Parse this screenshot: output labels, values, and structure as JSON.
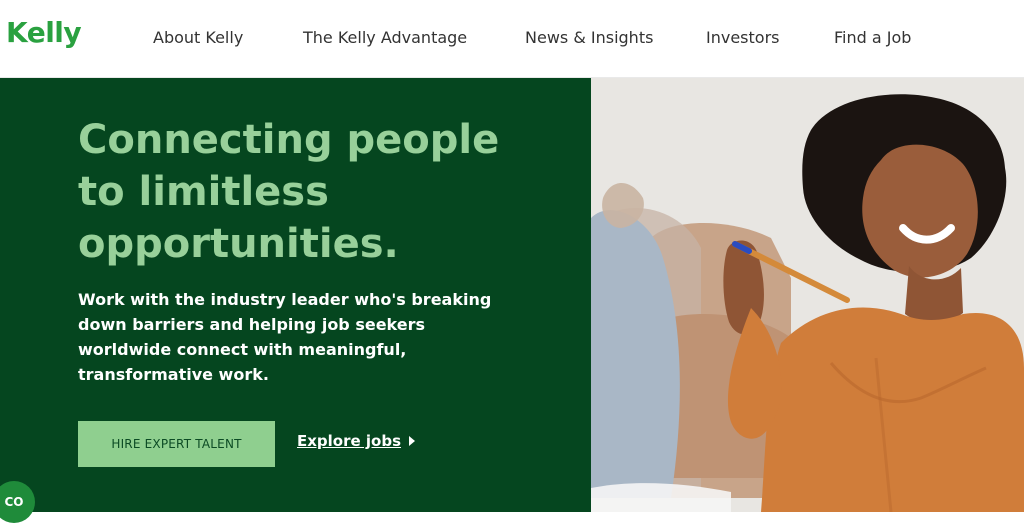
{
  "header": {
    "logo": "Kelly",
    "nav": [
      {
        "label": "About Kelly"
      },
      {
        "label": "The Kelly Advantage"
      },
      {
        "label": "News & Insights"
      },
      {
        "label": "Investors"
      },
      {
        "label": "Find a Job"
      }
    ]
  },
  "hero": {
    "headline_lines": [
      "Connecting people",
      "to limitless",
      "opportunities."
    ],
    "subtext_lines": [
      "Work with the industry leader who's breaking",
      "down barriers and helping job seekers",
      "worldwide connect with meaningful,",
      "transformative work."
    ],
    "primary_button": "HIRE EXPERT TALENT",
    "secondary_link": "Explore jobs"
  },
  "chat_widget": {
    "label": "CO"
  },
  "colors": {
    "brand_green": "#2aa140",
    "hero_background": "#05461f",
    "headline_green": "#98d09a",
    "button_green": "#8fcf8f"
  },
  "icons": {
    "explore_caret": "caret-right-icon"
  }
}
